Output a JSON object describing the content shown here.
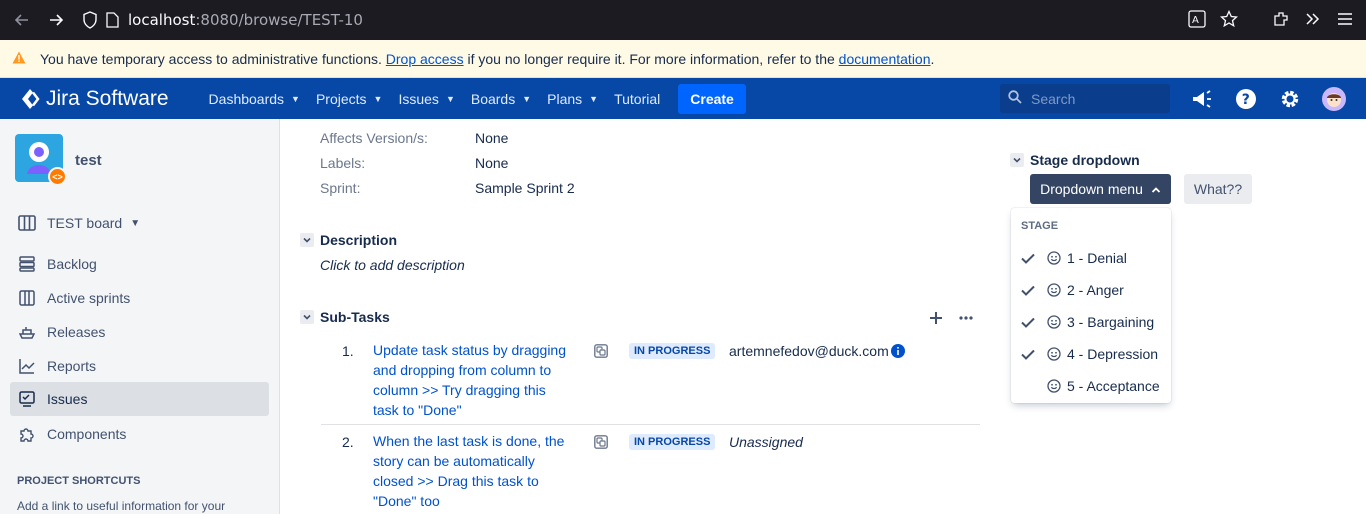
{
  "browser": {
    "url_host": "localhost",
    "url_rest": ":8080/browse/TEST-10"
  },
  "banner": {
    "text_before": "You have temporary access to administrative functions.",
    "drop_link": "Drop access",
    "text_middle": "if you no longer require it. For more information, refer to the",
    "doc_link": "documentation",
    "text_end": "."
  },
  "header": {
    "product": "Jira Software",
    "nav": [
      "Dashboards",
      "Projects",
      "Issues",
      "Boards",
      "Plans",
      "Tutorial"
    ],
    "create": "Create",
    "search_placeholder": "Search"
  },
  "sidebar": {
    "project_name": "test",
    "board": "TEST board",
    "items": [
      "Backlog",
      "Active sprints",
      "Releases",
      "Reports",
      "Issues",
      "Components"
    ],
    "active_item": "Issues",
    "shortcuts_heading": "PROJECT SHORTCUTS",
    "shortcuts_text": "Add a link to useful information for your"
  },
  "details": {
    "fields": [
      {
        "label": "Affects Version/s:",
        "value": "None"
      },
      {
        "label": "Labels:",
        "value": "None"
      },
      {
        "label": "Sprint:",
        "value": "Sample Sprint 2"
      }
    ],
    "description_title": "Description",
    "description_placeholder": "Click to add description",
    "subtasks_title": "Sub-Tasks",
    "subtasks": [
      {
        "num": "1.",
        "lines": [
          "Update task status by dragging",
          "and dropping from column to",
          "column >> Try dragging this",
          "task to \"Done\""
        ],
        "status": "IN PROGRESS",
        "assignee": "artemnefedov@duck.com"
      },
      {
        "num": "2.",
        "lines": [
          "When the last task is done, the",
          "story can be automatically",
          "closed >> Drag this task to",
          "\"Done\" too"
        ],
        "status": "IN PROGRESS",
        "assignee": "Unassigned"
      }
    ]
  },
  "stage": {
    "title": "Stage dropdown",
    "button": "Dropdown menu",
    "what": "What??",
    "menu_heading": "STAGE",
    "options": [
      {
        "label": "1 - Denial",
        "checked": true
      },
      {
        "label": "2 - Anger",
        "checked": true
      },
      {
        "label": "3 - Bargaining",
        "checked": true
      },
      {
        "label": "4 - Depression",
        "checked": true
      },
      {
        "label": "5 - Acceptance",
        "checked": false
      }
    ]
  },
  "colors": {
    "header_bg": "#0747a6",
    "banner_bg": "#fffae6",
    "link": "#0052cc",
    "status_bg": "#deebff"
  }
}
